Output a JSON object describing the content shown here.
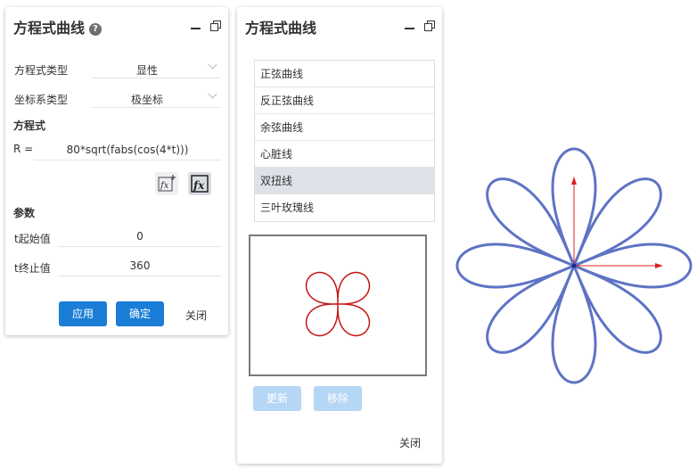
{
  "left_panel": {
    "title": "方程式曲线",
    "help_symbol": "?",
    "equation_type_label": "方程式类型",
    "equation_type_value": "显性",
    "coord_type_label": "坐标系类型",
    "coord_type_value": "极坐标",
    "equation_section": "方程式",
    "r_label": "R =",
    "r_value": "80*sqrt(fabs(cos(4*t)))",
    "params_section": "参数",
    "t_start_label": "t起始值",
    "t_start_value": "0",
    "t_end_label": "t终止值",
    "t_end_value": "360",
    "apply_label": "应用",
    "ok_label": "确定",
    "close_label": "关闭"
  },
  "right_panel": {
    "title": "方程式曲线",
    "curves": [
      "正弦曲线",
      "反正弦曲线",
      "余弦曲线",
      "心脏线",
      "双扭线",
      "三叶玫瑰线"
    ],
    "selected_index": 4,
    "update_label": "更新",
    "remove_label": "移除",
    "close_label": "关闭"
  },
  "colors": {
    "primary": "#1a7dd6",
    "disabled": "#b6d6f6",
    "selected_row": "#dde1e8",
    "preview_curve": "#c41212",
    "main_curve": "#5e73c4",
    "axis": "#e02020"
  },
  "icons": {
    "help": "help-icon",
    "minimize": "minimize-icon",
    "restore": "restore-window-icon",
    "fx_insert": "fx-insert-icon",
    "fx": "fx-icon"
  },
  "curves_drawn": {
    "preview": {
      "equation": "lemniscate",
      "petals": 4
    },
    "main": {
      "equation": "R = 80*sqrt(fabs(cos(4*t)))",
      "t_start": 0,
      "t_end": 360,
      "petals": 8
    }
  }
}
